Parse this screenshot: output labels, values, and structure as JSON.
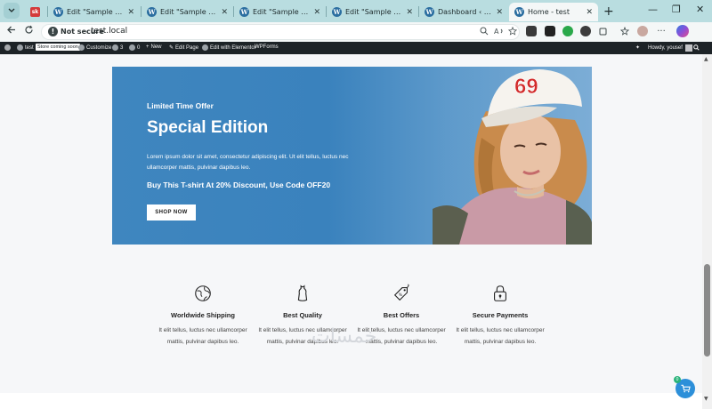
{
  "browser": {
    "tabs": [
      {
        "title": "",
        "favicon": "sk-icon",
        "active": false
      },
      {
        "title": "Edit \"Sample Page\" wi",
        "favicon": "wordpress-icon",
        "active": false
      },
      {
        "title": "Edit \"Sample Page\" wi",
        "favicon": "wordpress-icon",
        "active": false
      },
      {
        "title": "Edit \"Sample Page\" wi",
        "favicon": "wordpress-icon",
        "active": false
      },
      {
        "title": "Edit \"Sample Page\" wi",
        "favicon": "wordpress-icon",
        "active": false
      },
      {
        "title": "Dashboard ‹ test — W",
        "favicon": "wordpress-icon",
        "active": false
      },
      {
        "title": "Home - test",
        "favicon": "wordpress-icon",
        "active": true
      }
    ],
    "favicon_sk_text": "sk",
    "favicon_wp_text": "W",
    "tab_close": "✕",
    "new_tab": "+",
    "window_controls": {
      "minimize": "—",
      "maximize": "❐",
      "close": "✕"
    },
    "address": {
      "security": "Not secure",
      "url": "test.local"
    }
  },
  "admin_bar": {
    "site_name": "test",
    "badge": "Store coming soon",
    "customize": "Customize",
    "updates": "3",
    "comments": "0",
    "new": "New",
    "edit_page": "Edit Page",
    "elementor": "Edit with Elementor",
    "wpforms": "WPForms",
    "howdy": "Howdy, yousef"
  },
  "hero": {
    "small_title": "Limited Time Offer",
    "title": "Special Edition",
    "description": "Lorem ipsum dolor sit amet, consectetur adipiscing elit. Ut elit tellus, luctus nec ullamcorper mattis, pulvinar dapibus leo.",
    "offer": "Buy This T-shirt At 20% Discount, Use Code OFF20",
    "button": "SHOP NOW",
    "cap_number": "69"
  },
  "features": [
    {
      "icon": "globe-icon",
      "title": "Worldwide Shipping",
      "text": "It elit tellus, luctus nec ullamcorper mattis, pulvinar dapibus leo."
    },
    {
      "icon": "tshirt-icon",
      "title": "Best Quality",
      "text": "It elit tellus, luctus nec ullamcorper mattis, pulvinar dapibus leo."
    },
    {
      "icon": "tag-icon",
      "title": "Best Offers",
      "text": "It elit tellus, luctus nec ullamcorper mattis, pulvinar dapibus leo."
    },
    {
      "icon": "lock-icon",
      "title": "Secure Payments",
      "text": "It elit tellus, luctus nec ullamcorper mattis, pulvinar dapibus leo."
    }
  ],
  "cart": {
    "count": "0"
  },
  "watermark": "خمسات",
  "colors": {
    "hero_blue": "#3f86bf",
    "admin_bar": "#1d2327",
    "cart": "#2c8fd9"
  }
}
